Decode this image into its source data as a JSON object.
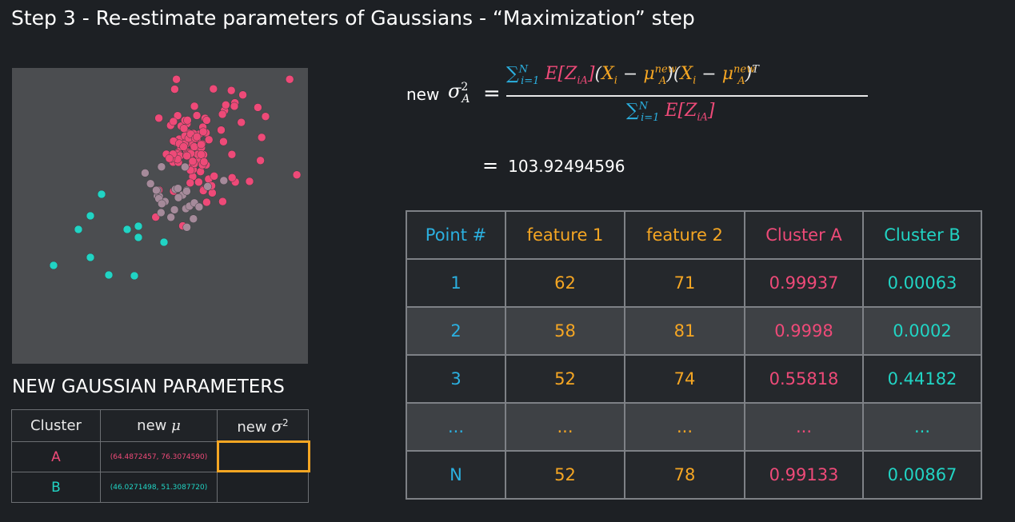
{
  "title": "Step 3 - Re-estimate parameters of Gaussians - “Maximization” step",
  "formula": {
    "lhs_label": "new",
    "result": "103.92494596"
  },
  "params": {
    "heading": "NEW GAUSSIAN PARAMETERS",
    "headers": {
      "cluster": "Cluster",
      "mu_prefix": "new",
      "sigma_prefix": "new"
    },
    "rows": [
      {
        "cluster": "A",
        "mu": "(64.4872457, 76.3074590)",
        "sigma": ""
      },
      {
        "cluster": "B",
        "mu": "(46.0271498, 51.3087720)",
        "sigma": ""
      }
    ]
  },
  "points_table": {
    "headers": [
      "Point #",
      "feature 1",
      "feature 2",
      "Cluster A",
      "Cluster B"
    ],
    "rows": [
      [
        "1",
        "62",
        "71",
        "0.99937",
        "0.00063"
      ],
      [
        "2",
        "58",
        "81",
        "0.9998",
        "0.0002"
      ],
      [
        "3",
        "52",
        "74",
        "0.55818",
        "0.44182"
      ],
      [
        "...",
        "...",
        "...",
        "...",
        "..."
      ],
      [
        "N",
        "52",
        "78",
        "0.99133",
        "0.00867"
      ]
    ]
  },
  "colors": {
    "cluster_a": "#ee4a78",
    "cluster_b": "#21d4c4",
    "mixed": "#a58a9a",
    "highlight": "#f5a623"
  },
  "scatter_data": {
    "cluster_a": [
      [
        62,
        71
      ],
      [
        58,
        81
      ],
      [
        52,
        74
      ],
      [
        52,
        78
      ]
    ],
    "cluster_b": [
      [
        46,
        51
      ]
    ]
  }
}
